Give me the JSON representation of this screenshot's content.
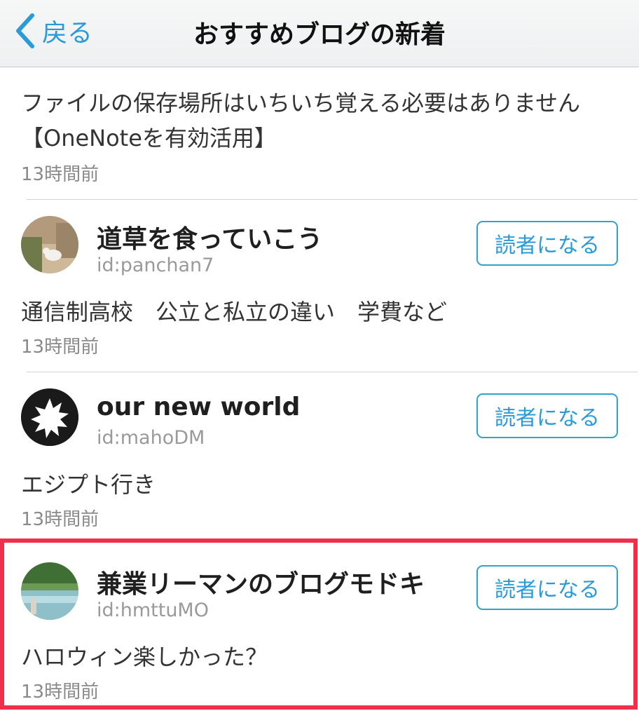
{
  "nav": {
    "back_label": "戻る",
    "title": "おすすめブログの新着"
  },
  "first_entry": {
    "title": "ファイルの保存場所はいちいち覚える必要はありません【OneNoteを有効活用】",
    "time": "13時間前"
  },
  "blogs": [
    {
      "name": "道草を食っていこう",
      "id": "id:panchan7",
      "subscribe_label": "読者になる",
      "entry_title": "通信制高校　公立と私立の違い　学費など",
      "time": "13時間前"
    },
    {
      "name": "our new world",
      "id": "id:mahoDM",
      "subscribe_label": "読者になる",
      "entry_title": "エジプト行き",
      "time": "13時間前"
    },
    {
      "name": "兼業リーマンのブログモドキ",
      "id": "id:hmttuMO",
      "subscribe_label": "読者になる",
      "entry_title": "ハロウィン楽しかった？",
      "time": "13時間前"
    }
  ],
  "colors": {
    "accent": "#2a9bd6",
    "highlight": "#f0304b"
  },
  "icons": {
    "back": "chevron-left-icon"
  }
}
